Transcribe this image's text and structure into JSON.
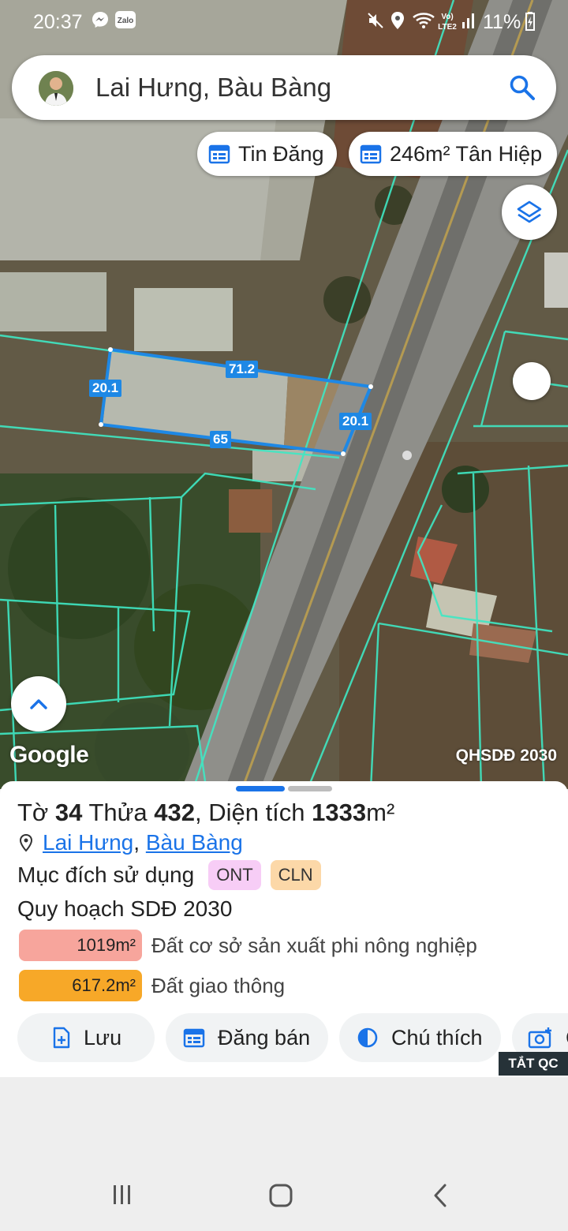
{
  "status_bar": {
    "time": "20:37",
    "battery": "11%",
    "icons": [
      "messenger-icon",
      "zalo-icon",
      "mute-icon",
      "location-icon",
      "wifi-icon",
      "volte-icon",
      "signal-icon",
      "charging-icon"
    ]
  },
  "search": {
    "query": "Lai Hưng, Bàu Bàng"
  },
  "chips": [
    {
      "label": "Tin Đăng",
      "icon": "calendar-icon"
    },
    {
      "label": "246m² Tân Hiệp",
      "icon": "calendar-icon"
    }
  ],
  "map": {
    "measurements": {
      "top": "71.2",
      "left": "20.1",
      "right": "20.1",
      "bottom": "65"
    },
    "attribution": "Google",
    "layer_label": "QHSDĐ 2030"
  },
  "parcel": {
    "to_label": "Tờ",
    "to_value": "34",
    "thua_label": "Thửa",
    "thua_value": "432",
    "area_label": ", Diện tích",
    "area_value": "1333",
    "area_unit": "m²",
    "location_part1": "Lai Hưng",
    "location_sep": ",",
    "location_part2": "Bàu Bàng",
    "purpose_label": "Mục đích sử dụng",
    "tags": [
      {
        "label": "ONT",
        "color": "#f7cdf6"
      },
      {
        "label": "CLN",
        "color": "#fcd8a8"
      }
    ],
    "plan_title": "Quy hoạch SDĐ 2030",
    "plans": [
      {
        "area": "1019m²",
        "label": "Đất cơ sở sản xuất phi nông nghiệp",
        "color": "#f7a59c"
      },
      {
        "area": "617.2m²",
        "label": "Đất giao thông",
        "color": "#f7a828"
      }
    ]
  },
  "actions": [
    {
      "label": "Lưu",
      "icon": "add-file-icon"
    },
    {
      "label": "Đăng bán",
      "icon": "calendar-icon"
    },
    {
      "label": "Chú thích",
      "icon": "half-circle-icon"
    },
    {
      "label": "C",
      "icon": "camera-plus-icon"
    }
  ],
  "ad_badge": "TẮT QC",
  "colors": {
    "accent": "#1a73e8",
    "parcel_outline": "#1e88e5",
    "parcel_lines": "#3fe8c4"
  }
}
